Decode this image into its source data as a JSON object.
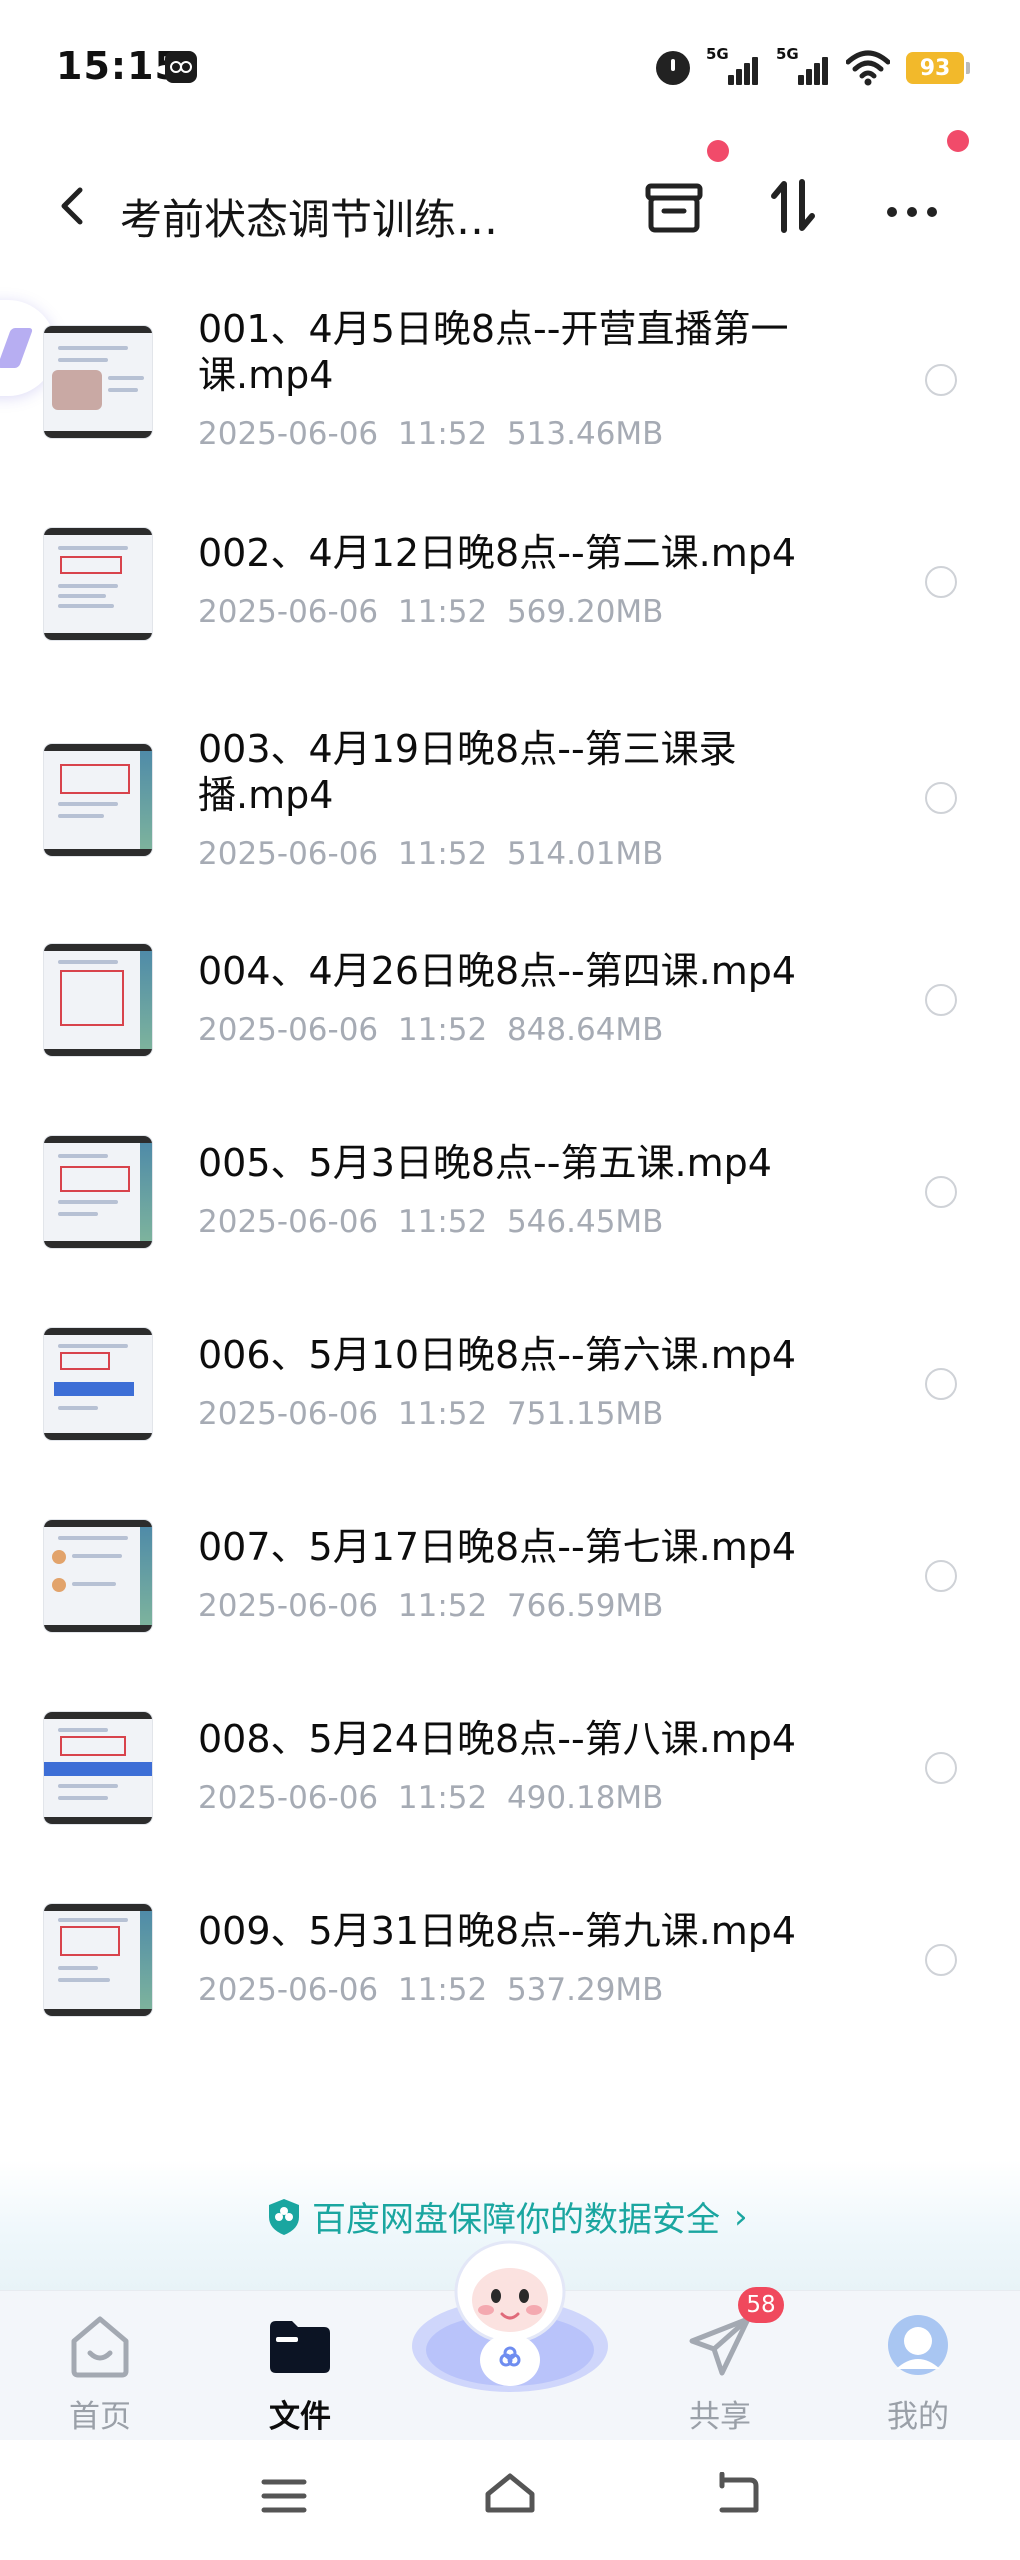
{
  "status_bar": {
    "time": "15:15",
    "signal_1_label": "5G",
    "signal_2_label": "5G",
    "battery": "93",
    "icons": [
      "app-icon",
      "alarm-icon",
      "signal-icon",
      "signal-icon",
      "wifi-icon",
      "battery-icon"
    ]
  },
  "header": {
    "title": "考前状态调节训练…",
    "icons": [
      "back-icon",
      "transfer-box-icon",
      "sort-icon",
      "more-icon"
    ],
    "accent_dot_color": "#f14b6a"
  },
  "files": [
    {
      "name": "001、4月5日晚8点--开营直播第一课.mp4",
      "date": "2025-06-06",
      "time": "11:52",
      "size": "513.46MB"
    },
    {
      "name": "002、4月12日晚8点--第二课.mp4",
      "date": "2025-06-06",
      "time": "11:52",
      "size": "569.20MB"
    },
    {
      "name": "003、4月19日晚8点--第三课录播.mp4",
      "date": "2025-06-06",
      "time": "11:52",
      "size": "514.01MB"
    },
    {
      "name": "004、4月26日晚8点--第四课.mp4",
      "date": "2025-06-06",
      "time": "11:52",
      "size": "848.64MB"
    },
    {
      "name": "005、5月3日晚8点--第五课.mp4",
      "date": "2025-06-06",
      "time": "11:52",
      "size": "546.45MB"
    },
    {
      "name": "006、5月10日晚8点--第六课.mp4",
      "date": "2025-06-06",
      "time": "11:52",
      "size": "751.15MB"
    },
    {
      "name": "007、5月17日晚8点--第七课.mp4",
      "date": "2025-06-06",
      "time": "11:52",
      "size": "766.59MB"
    },
    {
      "name": "008、5月24日晚8点--第八课.mp4",
      "date": "2025-06-06",
      "time": "11:52",
      "size": "490.18MB"
    },
    {
      "name": "009、5月31日晚8点--第九课.mp4",
      "date": "2025-06-06",
      "time": "11:52",
      "size": "537.29MB"
    }
  ],
  "safety_banner": {
    "text": "百度网盘保障你的数据安全",
    "chevron": "›",
    "color": "#1aa6a0"
  },
  "bottom_nav": {
    "items": [
      {
        "label": "首页",
        "icon": "home-icon",
        "active": false
      },
      {
        "label": "文件",
        "icon": "folder-icon",
        "active": true
      },
      {
        "label": "共享",
        "icon": "share-plane-icon",
        "active": false,
        "badge": "58"
      },
      {
        "label": "我的",
        "icon": "profile-icon",
        "active": false
      }
    ],
    "center_icon": "mascot-icon"
  },
  "system_nav": {
    "icons": [
      "menu-icon",
      "home-outline-icon",
      "back-arrow-icon"
    ]
  }
}
